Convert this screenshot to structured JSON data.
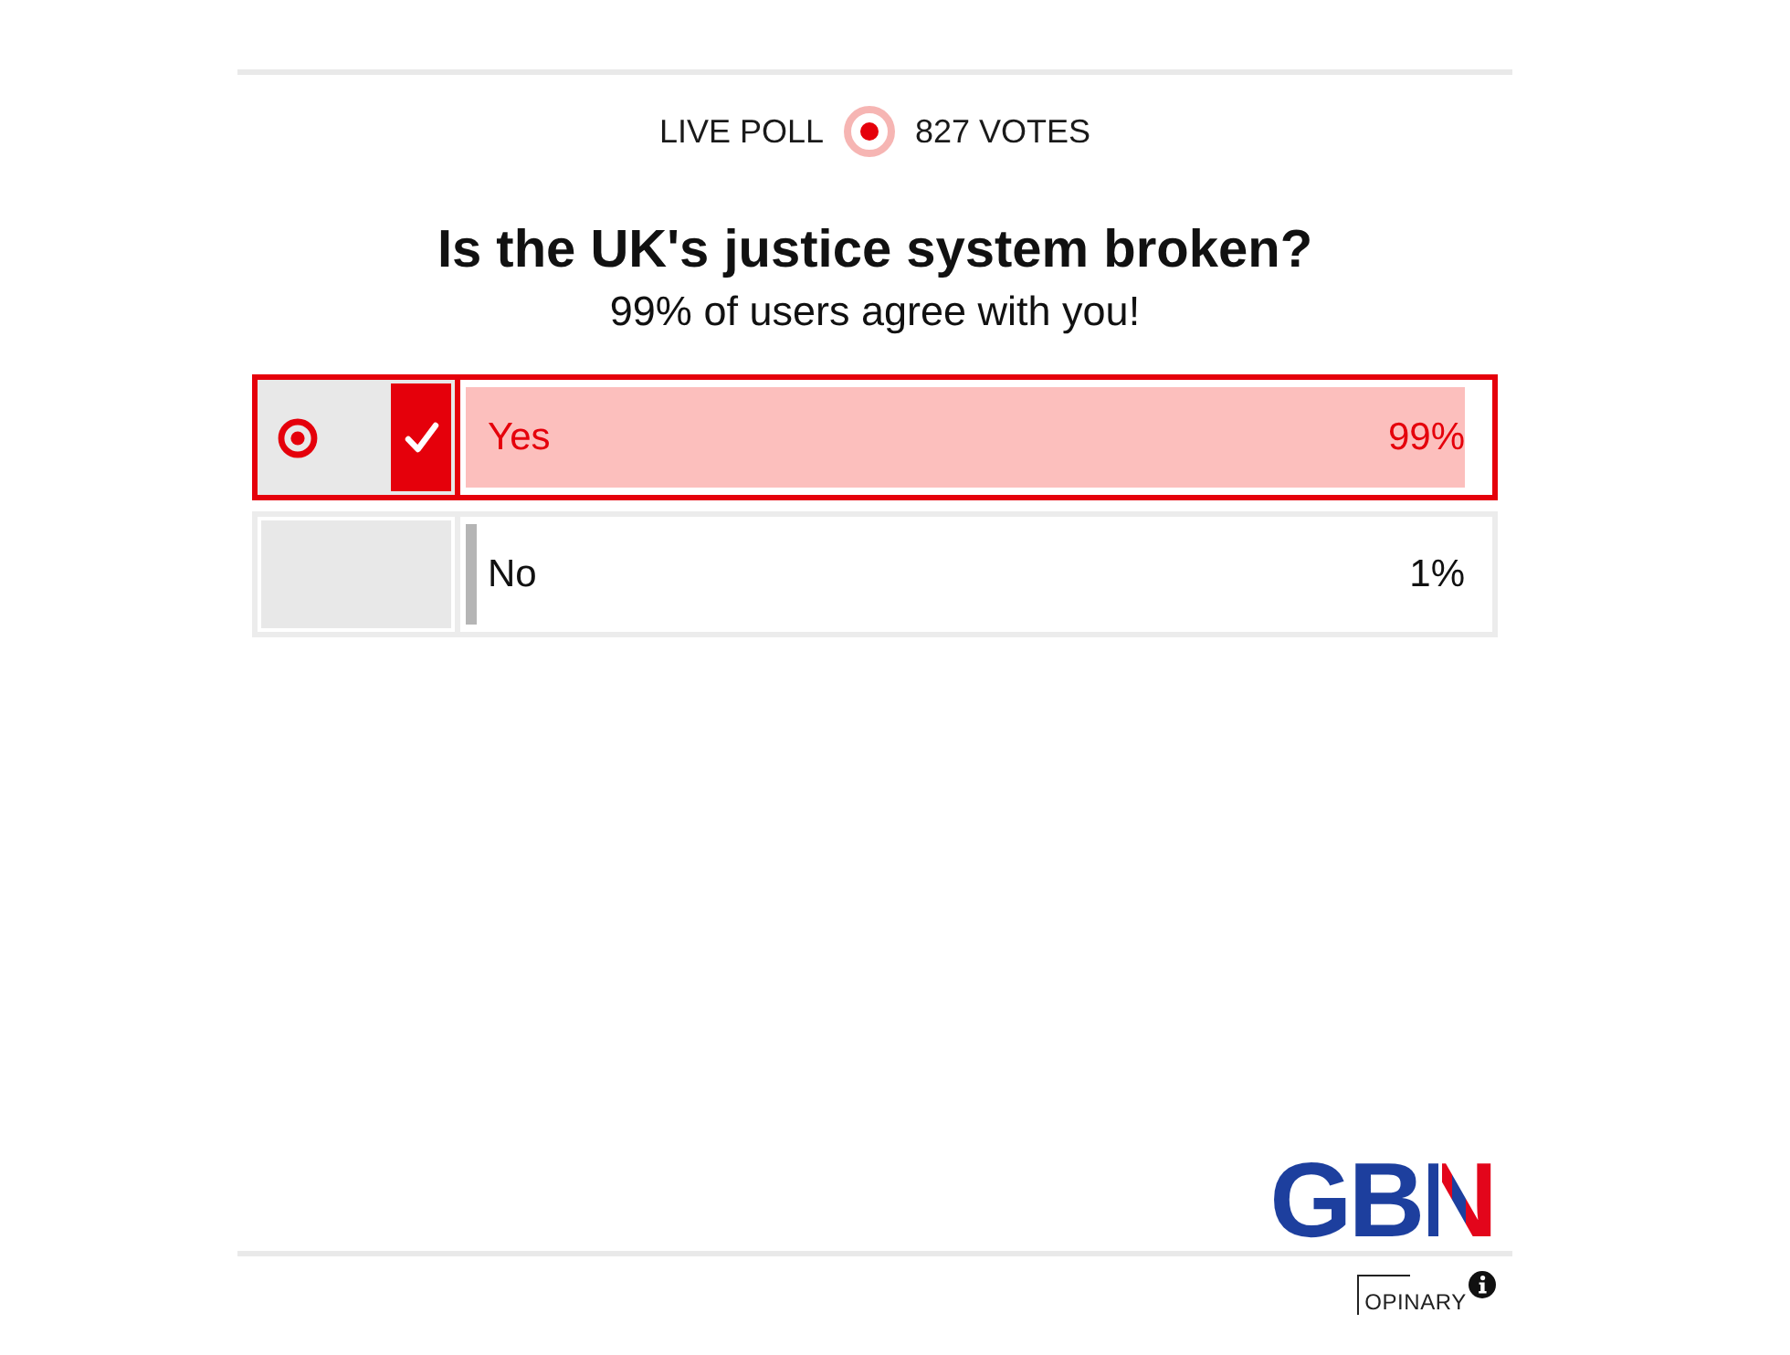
{
  "header": {
    "label": "LIVE POLL",
    "votes": "827 VOTES"
  },
  "question": "Is the UK's justice system broken?",
  "result_message": "99% of users agree with you!",
  "options": [
    {
      "label": "Yes",
      "percent": "99%",
      "level": 0.99,
      "selected": true
    },
    {
      "label": "No",
      "percent": "1%",
      "level": 0.01,
      "selected": false
    }
  ],
  "brand": {
    "logo": "GBN"
  },
  "footer": {
    "provider": "OPINARY"
  }
}
